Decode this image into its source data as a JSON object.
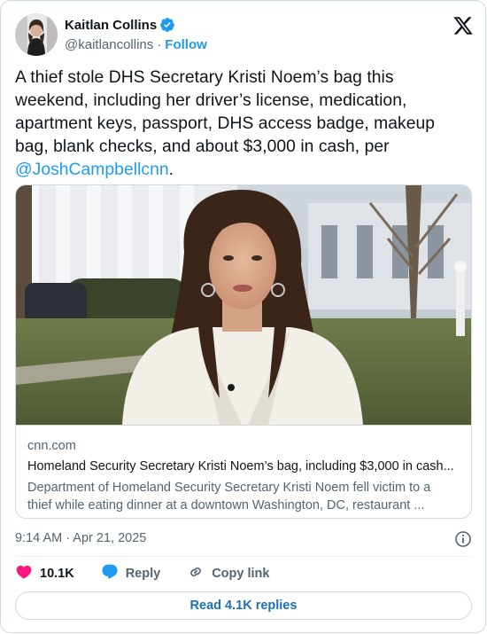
{
  "author": {
    "name": "Kaitlan Collins",
    "handle": "@kaitlancollins",
    "separator": "·",
    "follow_label": "Follow"
  },
  "tweet": {
    "lines": [
      "A thief stole DHS Secretary Kristi Noem’s bag this",
      "weekend, including her driver’s license, medication,",
      "apartment keys, passport, DHS access badge, makeup",
      "bag, blank checks, and about $3,000 in cash, per"
    ],
    "mention": "@JoshCampbellcnn",
    "end": "."
  },
  "link_card": {
    "domain": "cnn.com",
    "title": "Homeland Security Secretary Kristi Noem’s bag, including $3,000 in cash...",
    "description_lines": [
      "Department of Homeland Security Secretary Kristi Noem fell victim to a",
      "thief while eating dinner at a downtown Washington, DC, restaurant ..."
    ]
  },
  "meta": {
    "timestamp": "9:14 AM · Apr 21, 2025"
  },
  "actions": {
    "likes": "10.1K",
    "reply_label": "Reply",
    "copy_label": "Copy link"
  },
  "read_replies_label": "Read 4.1K replies",
  "icons": {
    "verified": "verified-badge-icon",
    "logo": "x-logo-icon",
    "info": "info-icon",
    "like": "heart-icon",
    "reply": "reply-bubble-icon",
    "copy": "link-icon"
  },
  "colors": {
    "accent": "#1d9bf0",
    "like": "#f91880",
    "text": "#0f1419",
    "secondary": "#536471"
  }
}
